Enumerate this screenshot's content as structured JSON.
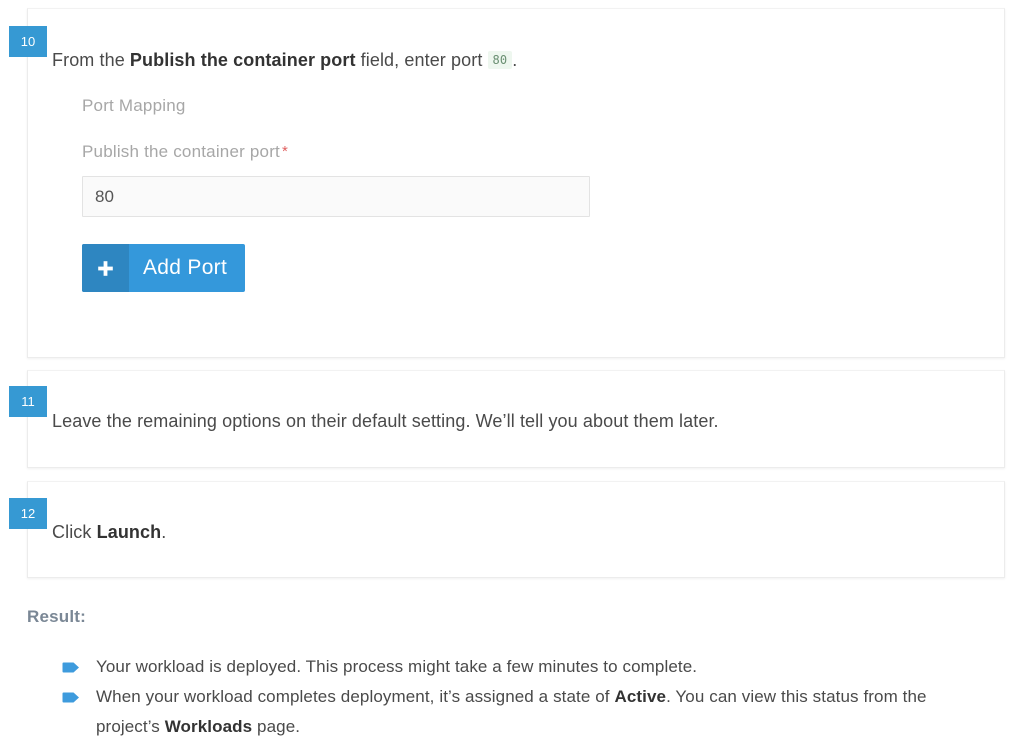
{
  "steps": [
    {
      "number": "10",
      "text_before_bold": "From the ",
      "bold": "Publish the container port",
      "text_after_bold": " field, enter port ",
      "code": "80",
      "text_end": "."
    },
    {
      "number": "11",
      "text": "Leave the remaining options on their default setting. We’ll tell you about them later."
    },
    {
      "number": "12",
      "text_before_bold": "Click ",
      "bold": "Launch",
      "text_after_bold": "."
    }
  ],
  "form": {
    "group_label": "Port Mapping",
    "field_label": "Publish the container port",
    "required_marker": "*",
    "port_value": "80",
    "port_placeholder": "",
    "add_port_button": "Add Port",
    "add_port_icon": "plus-icon"
  },
  "result": {
    "heading": "Result:",
    "bullet_icon": "blue-pennant-bullet-icon",
    "items": [
      {
        "text_1": "Your workload is deployed. This process might take a few minutes to complete.",
        "bold_1": "",
        "text_2": "",
        "bold_2": "",
        "text_3": ""
      },
      {
        "text_1": "When your workload completes deployment, it’s assigned a state of ",
        "bold_1": "Active",
        "text_2": ". You can view this status from the project’s ",
        "bold_2": "Workloads",
        "text_3": " page."
      }
    ]
  },
  "colors": {
    "accent_blue": "#3498db",
    "badge_blue": "#3699d3",
    "button_icon_blue": "#2e86c1",
    "code_bg": "#eef7ef",
    "code_text": "#6a8f72",
    "required_red": "#e06060",
    "label_gray": "#a7a7a7",
    "result_heading_gray": "#7a8795",
    "body_gray": "#4a4a4a"
  }
}
